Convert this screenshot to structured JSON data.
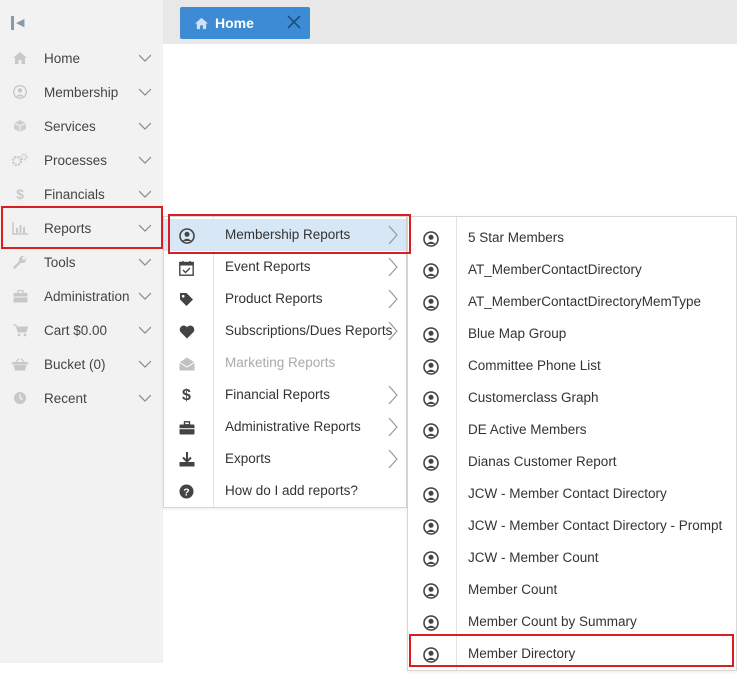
{
  "sidebar": {
    "collapse_icon": "collapse-left-icon",
    "items": [
      {
        "label": "Home",
        "icon": "home-icon"
      },
      {
        "label": "Membership",
        "icon": "user-circle-icon"
      },
      {
        "label": "Services",
        "icon": "cube-icon"
      },
      {
        "label": "Processes",
        "icon": "gears-icon"
      },
      {
        "label": "Financials",
        "icon": "dollar-icon"
      },
      {
        "label": "Reports",
        "icon": "bar-chart-icon"
      },
      {
        "label": "Tools",
        "icon": "wrench-icon"
      },
      {
        "label": "Administration",
        "icon": "briefcase-icon"
      },
      {
        "label": "Cart $0.00",
        "icon": "cart-icon"
      },
      {
        "label": "Bucket (0)",
        "icon": "basket-icon"
      },
      {
        "label": "Recent",
        "icon": "clock-icon"
      }
    ]
  },
  "tabs": [
    {
      "label": "Home",
      "icon": "home-icon",
      "close_icon": "close-icon"
    }
  ],
  "reports_menu": {
    "items": [
      {
        "label": "Membership Reports",
        "icon": "user-circle-icon",
        "submenu": true,
        "active": true
      },
      {
        "label": "Event Reports",
        "icon": "calendar-check-icon",
        "submenu": true
      },
      {
        "label": "Product Reports",
        "icon": "tag-icon",
        "submenu": true
      },
      {
        "label": "Subscriptions/Dues Reports",
        "icon": "heart-icon",
        "submenu": true
      },
      {
        "label": "Marketing Reports",
        "icon": "envelope-open-icon",
        "submenu": false,
        "disabled": true
      },
      {
        "label": "Financial Reports",
        "icon": "dollar-icon",
        "submenu": true
      },
      {
        "label": "Administrative Reports",
        "icon": "briefcase-icon",
        "submenu": true
      },
      {
        "label": "Exports",
        "icon": "download-icon",
        "submenu": true
      },
      {
        "label": "How do I add reports?",
        "icon": "question-circle-icon",
        "submenu": false
      }
    ]
  },
  "membership_reports_menu": {
    "items": [
      {
        "label": "5 Star Members",
        "icon": "user-circle-icon"
      },
      {
        "label": "AT_MemberContactDirectory",
        "icon": "user-circle-icon"
      },
      {
        "label": "AT_MemberContactDirectoryMemType",
        "icon": "user-circle-icon"
      },
      {
        "label": "Blue Map Group",
        "icon": "user-circle-icon"
      },
      {
        "label": "Committee Phone List",
        "icon": "user-circle-icon"
      },
      {
        "label": "Customerclass Graph",
        "icon": "user-circle-icon"
      },
      {
        "label": "DE Active Members",
        "icon": "user-circle-icon"
      },
      {
        "label": "Dianas Customer Report",
        "icon": "user-circle-icon"
      },
      {
        "label": "JCW - Member Contact Directory",
        "icon": "user-circle-icon"
      },
      {
        "label": "JCW - Member Contact Directory - Prompt",
        "icon": "user-circle-icon"
      },
      {
        "label": "JCW - Member Count",
        "icon": "user-circle-icon"
      },
      {
        "label": "Member Count",
        "icon": "user-circle-icon"
      },
      {
        "label": "Member Count by Summary",
        "icon": "user-circle-icon"
      },
      {
        "label": "Member Directory",
        "icon": "user-circle-icon"
      }
    ]
  },
  "colors": {
    "highlight_border": "#d81e1e",
    "tab_blue": "#3d8bd4",
    "menu_active_bg": "#d7e7f6",
    "sidebar_bg": "#f2f2f2"
  }
}
